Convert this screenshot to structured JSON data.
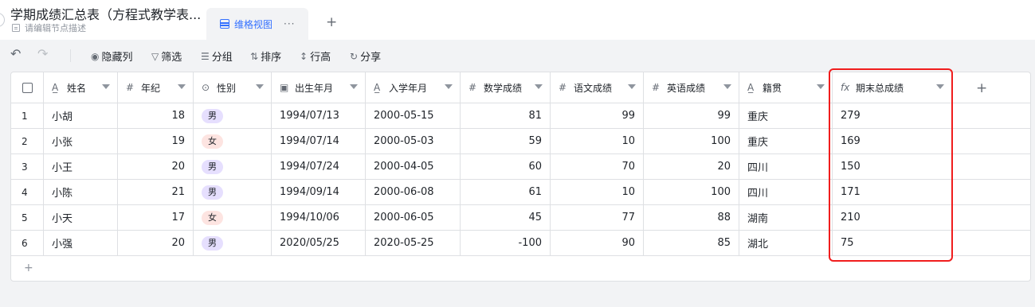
{
  "header": {
    "title": "学期成绩汇总表（方程式教学表...",
    "description": "请编辑节点描述",
    "view_tab_label": "维格视图",
    "view_tab_more": "···",
    "add_view": "+"
  },
  "toolbar": {
    "undo_icon": "undo-icon",
    "redo_icon": "redo-icon",
    "hide_columns": "隐藏列",
    "filter": "筛选",
    "group": "分组",
    "sort": "排序",
    "row_height": "行高",
    "share": "分享"
  },
  "grid": {
    "columns": [
      {
        "label": "姓名",
        "type_icon": "A̲",
        "icon_name": "text-field-icon"
      },
      {
        "label": "年纪",
        "type_icon": "#",
        "icon_name": "number-field-icon"
      },
      {
        "label": "性别",
        "type_icon": "⊙",
        "icon_name": "single-select-icon"
      },
      {
        "label": "出生年月",
        "type_icon": "▣",
        "icon_name": "date-field-icon"
      },
      {
        "label": "入学年月",
        "type_icon": "A̲",
        "icon_name": "text-field-icon"
      },
      {
        "label": "数学成绩",
        "type_icon": "#",
        "icon_name": "number-field-icon"
      },
      {
        "label": "语文成绩",
        "type_icon": "#",
        "icon_name": "number-field-icon"
      },
      {
        "label": "英语成绩",
        "type_icon": "#",
        "icon_name": "number-field-icon"
      },
      {
        "label": "籍贯",
        "type_icon": "A̲",
        "icon_name": "text-field-icon"
      },
      {
        "label": "期末总成绩",
        "type_icon": "fx",
        "icon_name": "formula-field-icon"
      }
    ],
    "add_column": "+",
    "add_row": "+",
    "rows": [
      {
        "idx": "1",
        "name": "小胡",
        "age": "18",
        "gender": "男",
        "birth": "1994/07/13",
        "enroll": "2000-05-15",
        "math": "81",
        "chinese": "99",
        "english": "99",
        "hometown": "重庆",
        "total": "279"
      },
      {
        "idx": "2",
        "name": "小张",
        "age": "19",
        "gender": "女",
        "birth": "1994/07/14",
        "enroll": "2000-05-03",
        "math": "59",
        "chinese": "10",
        "english": "100",
        "hometown": "重庆",
        "total": "169"
      },
      {
        "idx": "3",
        "name": "小王",
        "age": "20",
        "gender": "男",
        "birth": "1994/07/24",
        "enroll": "2000-04-05",
        "math": "60",
        "chinese": "70",
        "english": "20",
        "hometown": "四川",
        "total": "150"
      },
      {
        "idx": "4",
        "name": "小陈",
        "age": "21",
        "gender": "男",
        "birth": "1994/09/14",
        "enroll": "2000-06-08",
        "math": "61",
        "chinese": "10",
        "english": "100",
        "hometown": "四川",
        "total": "171"
      },
      {
        "idx": "5",
        "name": "小天",
        "age": "17",
        "gender": "女",
        "birth": "1994/10/06",
        "enroll": "2000-06-05",
        "math": "45",
        "chinese": "77",
        "english": "88",
        "hometown": "湖南",
        "total": "210"
      },
      {
        "idx": "6",
        "name": "小强",
        "age": "20",
        "gender": "男",
        "birth": "2020/05/25",
        "enroll": "2020-05-25",
        "math": "-100",
        "chinese": "90",
        "english": "85",
        "hometown": "湖北",
        "total": "75"
      }
    ]
  },
  "colors": {
    "accent": "#3370ff",
    "highlight": "#f01d1d",
    "male_tag": "#e6dffe",
    "female_tag": "#fde4e1"
  }
}
